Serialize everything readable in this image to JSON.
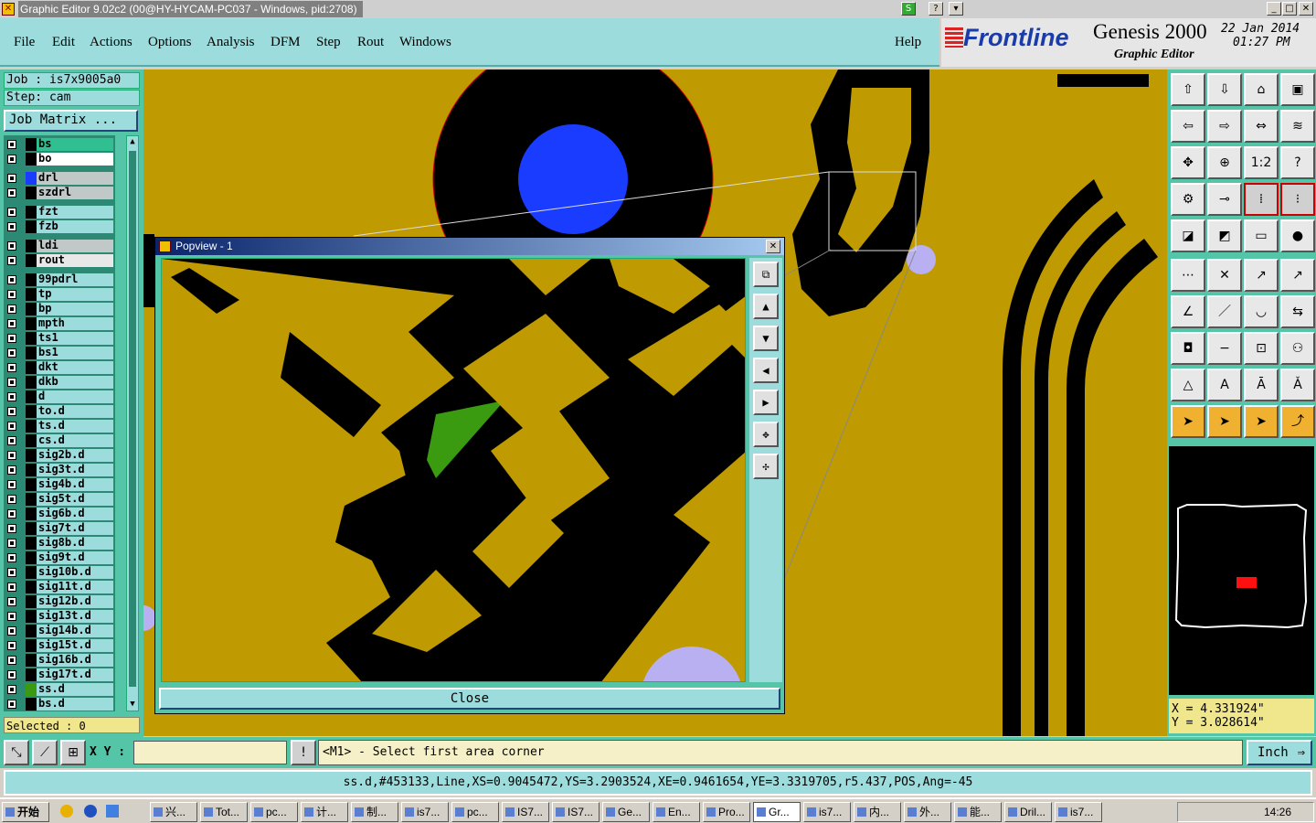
{
  "window": {
    "title": "Graphic Editor 9.02c2 (00@HY-HYCAM-PC037 - Windows, pid:2708)"
  },
  "menu": [
    "File",
    "Edit",
    "Actions",
    "Options",
    "Analysis",
    "DFM",
    "Step",
    "Rout",
    "Windows"
  ],
  "help": "Help",
  "brand": {
    "logo": "Frontline",
    "product": "Genesis 2000",
    "subtitle": "Graphic Editor",
    "date": "22 Jan 2014",
    "time": "01:27 PM"
  },
  "job": {
    "job_label": "Job : is7x9005a0",
    "step_label": "Step: cam",
    "matrix_button": "Job Matrix ..."
  },
  "layers": [
    {
      "name": "bs",
      "color": "#000000"
    },
    {
      "name": "bo",
      "color": "#000000"
    },
    {
      "name": "drl",
      "color": "#1a3cff"
    },
    {
      "name": "szdrl",
      "color": "#000000"
    },
    {
      "name": "fzt",
      "color": "#000000"
    },
    {
      "name": "fzb",
      "color": "#000000"
    },
    {
      "name": "ldi",
      "color": "#000000"
    },
    {
      "name": "rout",
      "color": "#000000"
    },
    {
      "name": "99pdrl",
      "color": "#000000"
    },
    {
      "name": "tp",
      "color": "#000000"
    },
    {
      "name": "bp",
      "color": "#000000"
    },
    {
      "name": "mpth",
      "color": "#000000"
    },
    {
      "name": "ts1",
      "color": "#000000"
    },
    {
      "name": "bs1",
      "color": "#000000"
    },
    {
      "name": "dkt",
      "color": "#000000"
    },
    {
      "name": "dkb",
      "color": "#000000"
    },
    {
      "name": "d",
      "color": "#000000"
    },
    {
      "name": "to.d",
      "color": "#000000"
    },
    {
      "name": "ts.d",
      "color": "#000000"
    },
    {
      "name": "cs.d",
      "color": "#000000"
    },
    {
      "name": "sig2b.d",
      "color": "#000000"
    },
    {
      "name": "sig3t.d",
      "color": "#000000"
    },
    {
      "name": "sig4b.d",
      "color": "#000000"
    },
    {
      "name": "sig5t.d",
      "color": "#000000"
    },
    {
      "name": "sig6b.d",
      "color": "#000000"
    },
    {
      "name": "sig7t.d",
      "color": "#000000"
    },
    {
      "name": "sig8b.d",
      "color": "#000000"
    },
    {
      "name": "sig9t.d",
      "color": "#000000"
    },
    {
      "name": "sig10b.d",
      "color": "#000000"
    },
    {
      "name": "sig11t.d",
      "color": "#000000"
    },
    {
      "name": "sig12b.d",
      "color": "#000000"
    },
    {
      "name": "sig13t.d",
      "color": "#000000"
    },
    {
      "name": "sig14b.d",
      "color": "#000000"
    },
    {
      "name": "sig15t.d",
      "color": "#000000"
    },
    {
      "name": "sig16b.d",
      "color": "#000000"
    },
    {
      "name": "sig17t.d",
      "color": "#000000"
    },
    {
      "name": "ss.d",
      "color": "#3a9a10"
    },
    {
      "name": "bs.d",
      "color": "#000000"
    }
  ],
  "selected": "Selected : 0",
  "popup": {
    "title": "Popview - 1",
    "close": "Close"
  },
  "coords": {
    "x": "X = 4.331924\"",
    "y": "Y = 3.028614\""
  },
  "toolbar": {
    "ratio_label": "1:2",
    "help_label": "?"
  },
  "status": {
    "xy_label": "X Y :",
    "xy_value": "",
    "prompt": "<M1> - Select first area corner",
    "unit": "Inch"
  },
  "infoline": "ss.d,#453133,Line,XS=0.9045472,YS=3.2903524,XE=0.9461654,YE=3.3319705,r5.437,POS,Ang=-45",
  "taskbar": {
    "start": "开始",
    "clock": "14:26",
    "tasks": [
      "兴...",
      "Tot...",
      "pc...",
      "计...",
      "制...",
      "is7...",
      "pc...",
      "IS7...",
      "IS7...",
      "Ge...",
      "En...",
      "Pro...",
      "Gr...",
      "is7...",
      "内...",
      "外...",
      "能...",
      "Dril...",
      "is7..."
    ]
  },
  "colors": {
    "accent": "#9ddcdc",
    "panel": "#55c5a8",
    "copper": "#bf9a00"
  }
}
